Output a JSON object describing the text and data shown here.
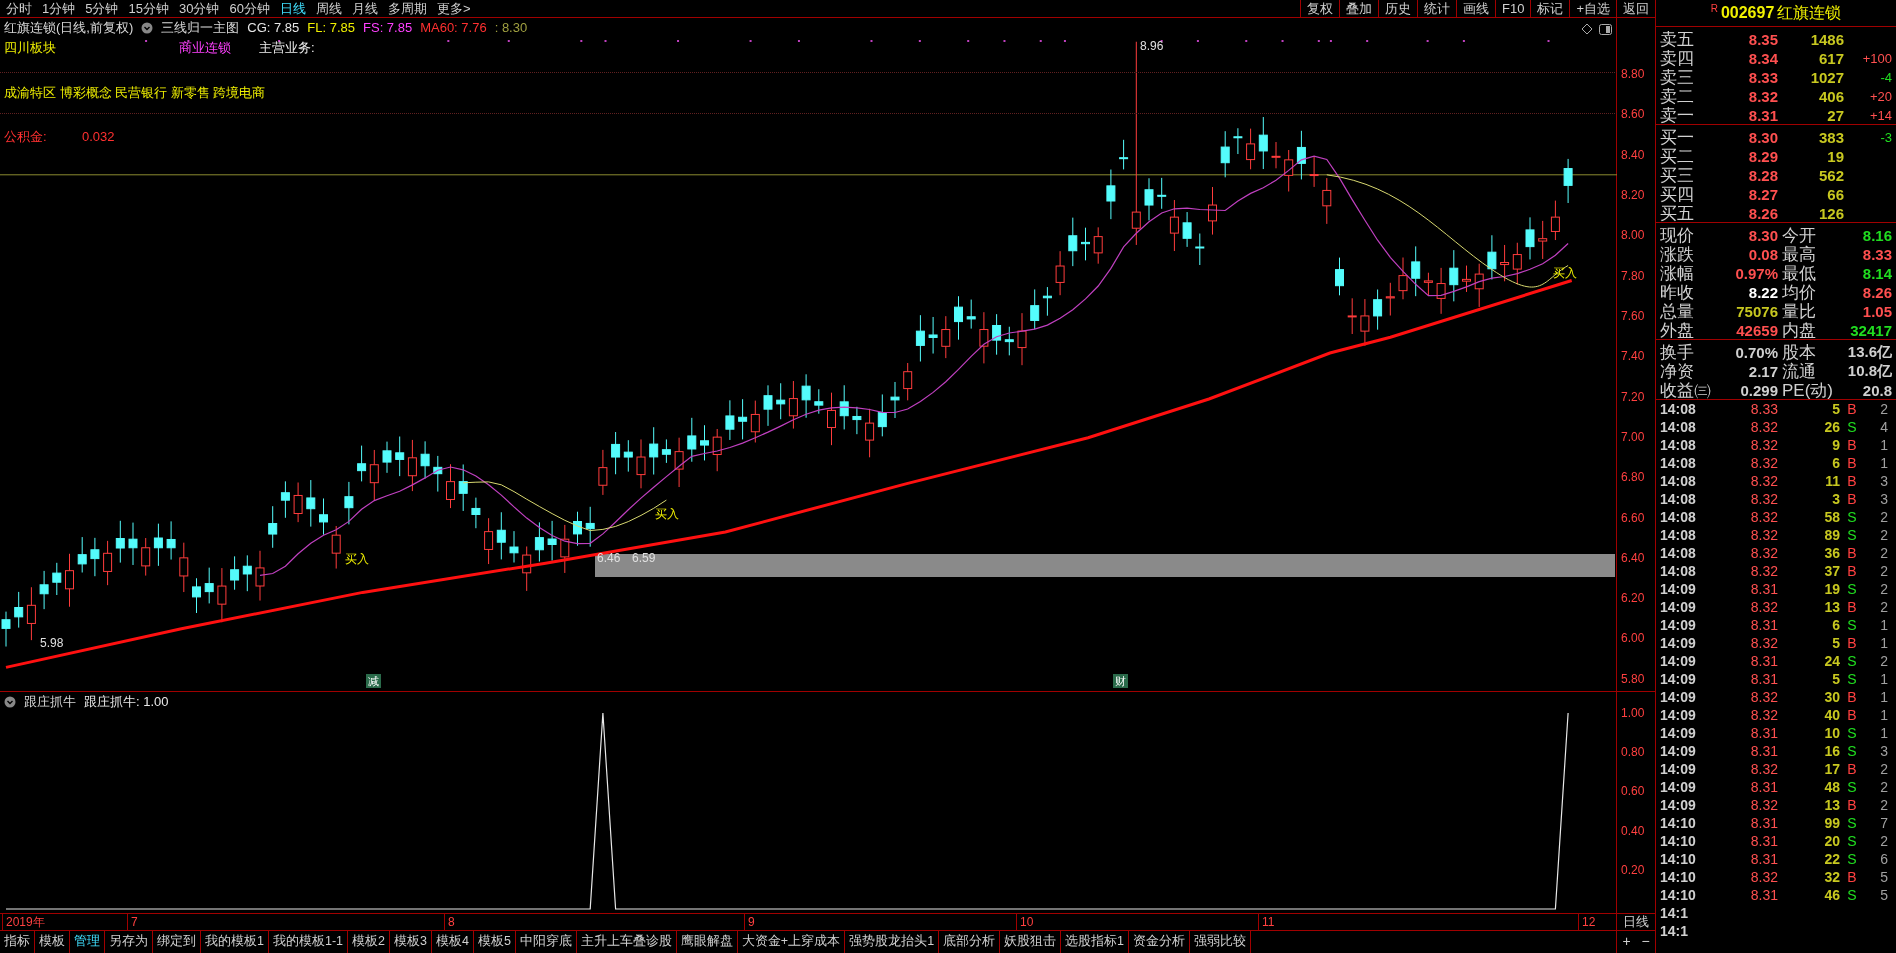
{
  "period_tabs": [
    {
      "label": "分时",
      "selected": false
    },
    {
      "label": "1分钟",
      "selected": false
    },
    {
      "label": "5分钟",
      "selected": false
    },
    {
      "label": "15分钟",
      "selected": false
    },
    {
      "label": "30分钟",
      "selected": false
    },
    {
      "label": "60分钟",
      "selected": false
    },
    {
      "label": "日线",
      "selected": true
    },
    {
      "label": "周线",
      "selected": false
    },
    {
      "label": "月线",
      "selected": false
    },
    {
      "label": "多周期",
      "selected": false
    },
    {
      "label": "更多>",
      "selected": false
    }
  ],
  "toolbar_buttons": [
    "复权",
    "叠加",
    "历史",
    "统计",
    "画线",
    "F10",
    "标记",
    "+自选",
    "返回"
  ],
  "chart": {
    "title": "红旗连锁(日线,前复权)",
    "formula": "三线归一主图",
    "legend": [
      {
        "label": "CG: 7.85",
        "color": "#e6e6e6"
      },
      {
        "label": "FL: 7.85",
        "color": "#f0f000"
      },
      {
        "label": "FS: 7.85",
        "color": "#ff40ff"
      },
      {
        "label": "MA60: 7.76",
        "color": "#ff3030"
      },
      {
        "label": ": 8.30",
        "color": "#a0a040"
      }
    ],
    "info": {
      "region": "四川板块",
      "industry": "商业连锁",
      "business_label": "主营业务:",
      "concepts": "成渝特区 博彩概念 民营银行 新零售 跨境电商",
      "fund_label": "公积金:",
      "fund_value": "0.032"
    },
    "y_axis": [
      "8.80",
      "8.60",
      "8.40",
      "8.20",
      "8.00",
      "7.80",
      "7.60",
      "7.40",
      "7.20",
      "7.00",
      "6.80",
      "6.60",
      "6.40",
      "6.20",
      "6.00",
      "5.80"
    ],
    "annotations": [
      {
        "kind": "high",
        "text": "8.96"
      },
      {
        "kind": "low",
        "text": "5.98"
      },
      {
        "kind": "signal",
        "text": "买入"
      },
      {
        "kind": "price",
        "text": "6.46"
      },
      {
        "kind": "price",
        "text": "6.59"
      },
      {
        "kind": "signal",
        "text": "买入"
      },
      {
        "kind": "signal",
        "text": "买入"
      },
      {
        "kind": "event",
        "text": "减"
      },
      {
        "kind": "event",
        "text": "财"
      }
    ]
  },
  "indicator": {
    "name": "跟庄抓牛",
    "reading": "跟庄抓牛: 1.00",
    "y_axis": [
      "1.00",
      "0.80",
      "0.60",
      "0.40",
      "0.20"
    ]
  },
  "x_axis": {
    "labels": [
      "2019年",
      "7",
      "8",
      "9",
      "10",
      "11",
      "12"
    ],
    "period": "日线"
  },
  "bottom_tabs": [
    {
      "label": "指标",
      "selected": false
    },
    {
      "label": "模板",
      "selected": false
    },
    {
      "label": "管理",
      "selected": true
    },
    {
      "label": "另存为",
      "selected": false
    },
    {
      "label": "绑定到",
      "selected": false
    },
    {
      "label": "我的模板1",
      "selected": false
    },
    {
      "label": "我的模板1-1",
      "selected": false
    },
    {
      "label": "模板2",
      "selected": false
    },
    {
      "label": "模板3",
      "selected": false
    },
    {
      "label": "模板4",
      "selected": false
    },
    {
      "label": "模板5",
      "selected": false
    },
    {
      "label": "中阳穿底",
      "selected": false
    },
    {
      "label": "主升上车叠诊股",
      "selected": false
    },
    {
      "label": "鹰眼解盘",
      "selected": false
    },
    {
      "label": "大资金+上穿成本",
      "selected": false
    },
    {
      "label": "强势股龙抬头1",
      "selected": false
    },
    {
      "label": "底部分析",
      "selected": false
    },
    {
      "label": "妖股狙击",
      "selected": false
    },
    {
      "label": "选股指标1",
      "selected": false
    },
    {
      "label": "资金分析",
      "selected": false
    },
    {
      "label": "强弱比较",
      "selected": false
    }
  ],
  "zoom_buttons": [
    "+",
    "−"
  ],
  "quote": {
    "flag": "R",
    "code": "002697",
    "name": "红旗连锁",
    "asks": [
      {
        "label": "卖五",
        "price": "8.35",
        "volume": "1486"
      },
      {
        "label": "卖四",
        "price": "8.34",
        "volume": "617",
        "change": "+100",
        "color": "#ff5050"
      },
      {
        "label": "卖三",
        "price": "8.33",
        "volume": "1027",
        "change": "-4",
        "color": "#20dd20"
      },
      {
        "label": "卖二",
        "price": "8.32",
        "volume": "406",
        "change": "+20",
        "color": "#ff5050"
      },
      {
        "label": "卖一",
        "price": "8.31",
        "volume": "27",
        "change": "+14",
        "color": "#ff5050"
      }
    ],
    "bids": [
      {
        "label": "买一",
        "price": "8.30",
        "volume": "383",
        "change": "-3",
        "color": "#20dd20"
      },
      {
        "label": "买二",
        "price": "8.29",
        "volume": "19"
      },
      {
        "label": "买三",
        "price": "8.28",
        "volume": "562"
      },
      {
        "label": "买四",
        "price": "8.27",
        "volume": "66"
      },
      {
        "label": "买五",
        "price": "8.26",
        "volume": "126"
      }
    ],
    "stats": [
      {
        "label": "现价",
        "value": "8.30",
        "color": "#ff5050"
      },
      {
        "label": "今开",
        "value": "8.16",
        "color": "#20dd20"
      },
      {
        "label": "涨跌",
        "value": "0.08",
        "color": "#ff5050"
      },
      {
        "label": "最高",
        "value": "8.33",
        "color": "#ff5050"
      },
      {
        "label": "涨幅",
        "value": "0.97%",
        "color": "#ff5050"
      },
      {
        "label": "最低",
        "value": "8.14",
        "color": "#20dd20"
      },
      {
        "label": "昨收",
        "value": "8.22",
        "color": "#ffffff"
      },
      {
        "label": "均价",
        "value": "8.26",
        "color": "#ff5050"
      },
      {
        "label": "总量",
        "value": "75076",
        "color": "#c8c820"
      },
      {
        "label": "量比",
        "value": "1.05",
        "color": "#ff5050"
      },
      {
        "label": "外盘",
        "value": "42659",
        "color": "#ff5050"
      },
      {
        "label": "内盘",
        "value": "32417",
        "color": "#20dd20"
      }
    ],
    "fundamentals": [
      {
        "label": "换手",
        "value": "0.70%"
      },
      {
        "label": "股本",
        "value": "13.6亿"
      },
      {
        "label": "净资",
        "value": "2.17"
      },
      {
        "label": "流通",
        "value": "10.8亿"
      },
      {
        "label": "收益㈢",
        "value": "0.299"
      },
      {
        "label": "PE(动)",
        "value": "20.8"
      }
    ],
    "trades": [
      {
        "time": "14:08",
        "price": "8.33",
        "volume": "5",
        "side": "B",
        "kind": "buy",
        "count": "2"
      },
      {
        "time": "14:08",
        "price": "8.32",
        "volume": "26",
        "side": "S",
        "kind": "sell",
        "count": "4"
      },
      {
        "time": "14:08",
        "price": "8.32",
        "volume": "9",
        "side": "B",
        "kind": "buy",
        "count": "1"
      },
      {
        "time": "14:08",
        "price": "8.32",
        "volume": "6",
        "side": "B",
        "kind": "buy",
        "count": "1"
      },
      {
        "time": "14:08",
        "price": "8.32",
        "volume": "11",
        "side": "B",
        "kind": "buy",
        "count": "3"
      },
      {
        "time": "14:08",
        "price": "8.32",
        "volume": "3",
        "side": "B",
        "kind": "buy",
        "count": "3"
      },
      {
        "time": "14:08",
        "price": "8.32",
        "volume": "58",
        "side": "S",
        "kind": "sell",
        "count": "2"
      },
      {
        "time": "14:08",
        "price": "8.32",
        "volume": "89",
        "side": "S",
        "kind": "sell",
        "count": "2"
      },
      {
        "time": "14:08",
        "price": "8.32",
        "volume": "36",
        "side": "B",
        "kind": "buy",
        "count": "2"
      },
      {
        "time": "14:08",
        "price": "8.32",
        "volume": "37",
        "side": "B",
        "kind": "buy",
        "count": "2"
      },
      {
        "time": "14:09",
        "price": "8.31",
        "volume": "19",
        "side": "S",
        "kind": "sell",
        "count": "2"
      },
      {
        "time": "14:09",
        "price": "8.32",
        "volume": "13",
        "side": "B",
        "kind": "buy",
        "count": "2"
      },
      {
        "time": "14:09",
        "price": "8.31",
        "volume": "6",
        "side": "S",
        "kind": "sell",
        "count": "1"
      },
      {
        "time": "14:09",
        "price": "8.32",
        "volume": "5",
        "side": "B",
        "kind": "buy",
        "count": "1"
      },
      {
        "time": "14:09",
        "price": "8.31",
        "volume": "24",
        "side": "S",
        "kind": "sell",
        "count": "2"
      },
      {
        "time": "14:09",
        "price": "8.31",
        "volume": "5",
        "side": "S",
        "kind": "sell",
        "count": "1"
      },
      {
        "time": "14:09",
        "price": "8.32",
        "volume": "30",
        "side": "B",
        "kind": "buy",
        "count": "1"
      },
      {
        "time": "14:09",
        "price": "8.32",
        "volume": "40",
        "side": "B",
        "kind": "buy",
        "count": "1"
      },
      {
        "time": "14:09",
        "price": "8.31",
        "volume": "10",
        "side": "S",
        "kind": "sell",
        "count": "1"
      },
      {
        "time": "14:09",
        "price": "8.31",
        "volume": "16",
        "side": "S",
        "kind": "sell",
        "count": "3"
      },
      {
        "time": "14:09",
        "price": "8.32",
        "volume": "17",
        "side": "B",
        "kind": "buy",
        "count": "2"
      },
      {
        "time": "14:09",
        "price": "8.31",
        "volume": "48",
        "side": "S",
        "kind": "sell",
        "count": "2"
      },
      {
        "time": "14:09",
        "price": "8.32",
        "volume": "13",
        "side": "B",
        "kind": "buy",
        "count": "2"
      },
      {
        "time": "14:10",
        "price": "8.31",
        "volume": "99",
        "side": "S",
        "kind": "sell",
        "count": "7"
      },
      {
        "time": "14:10",
        "price": "8.31",
        "volume": "20",
        "side": "S",
        "kind": "sell",
        "count": "2"
      },
      {
        "time": "14:10",
        "price": "8.31",
        "volume": "22",
        "side": "S",
        "kind": "sell",
        "count": "6"
      },
      {
        "time": "14:10",
        "price": "8.32",
        "volume": "32",
        "side": "B",
        "kind": "buy",
        "count": "5"
      },
      {
        "time": "14:10",
        "price": "8.31",
        "volume": "46",
        "side": "S",
        "kind": "sell",
        "count": "5"
      },
      {
        "time": "14:1"
      },
      {
        "time": "14:1"
      }
    ]
  }
}
